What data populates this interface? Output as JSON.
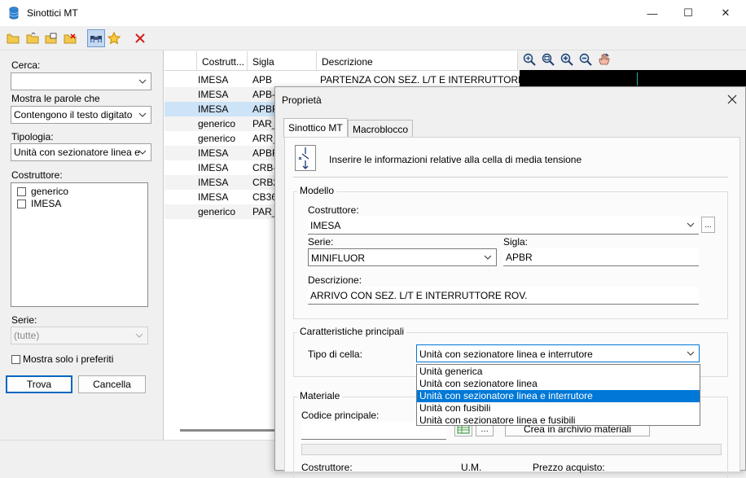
{
  "window": {
    "title": "Sinottici MT",
    "controls": {
      "minimize": "—",
      "maximize": "☐",
      "close": "✕"
    }
  },
  "toolbar": {
    "icons": [
      "new-folder-icon",
      "open-folder-icon",
      "copy-icon",
      "delete-folder-icon",
      "binoculars-icon",
      "star-icon",
      "close-red-icon"
    ]
  },
  "search": {
    "cerca_label": "Cerca:",
    "cerca_value": "",
    "mostra_label": "Mostra le parole che",
    "mostra_value": "Contengono il testo digitato",
    "tipologia_label": "Tipologia:",
    "tipologia_value": "Unità con sezionatore linea e",
    "costruttore_label": "Costruttore:",
    "costruttori": [
      "generico",
      "IMESA"
    ],
    "serie_label": "Serie:",
    "serie_value": "(tutte)",
    "preferiti_label": "Mostra solo i preferiti",
    "trova_label": "Trova",
    "cancella_label": "Cancella"
  },
  "grid": {
    "headers": [
      "Costrutt...",
      "Sigla",
      "Descrizione"
    ],
    "rows": [
      {
        "costruttore": "IMESA",
        "sigla": "APB",
        "descrizione": "PARTENZA CON SEZ. L/T E INTERRUTTORE"
      },
      {
        "costruttore": "IMESA",
        "sigla": "APB-",
        "descrizione": ""
      },
      {
        "costruttore": "IMESA",
        "sigla": "APBR",
        "descrizione": ""
      },
      {
        "costruttore": "generico",
        "sigla": "PAR_",
        "descrizione": ""
      },
      {
        "costruttore": "generico",
        "sigla": "ARR_",
        "descrizione": ""
      },
      {
        "costruttore": "IMESA",
        "sigla": "APBR",
        "descrizione": ""
      },
      {
        "costruttore": "IMESA",
        "sigla": "CRB-",
        "descrizione": ""
      },
      {
        "costruttore": "IMESA",
        "sigla": "CRB2",
        "descrizione": ""
      },
      {
        "costruttore": "IMESA",
        "sigla": "CB36",
        "descrizione": ""
      },
      {
        "costruttore": "generico",
        "sigla": "PAR_",
        "descrizione": ""
      }
    ],
    "selected_row": 2
  },
  "preview_toolbar": {
    "icons": [
      "zoom-fit-icon",
      "zoom-window-icon",
      "zoom-in-icon",
      "zoom-out-icon",
      "pan-icon"
    ]
  },
  "dialog": {
    "title": "Proprietà",
    "tabs": [
      "Sinottico MT",
      "Macroblocco"
    ],
    "info_text": "Inserire le informazioni relative alla cella di media tensione",
    "modello": {
      "title": "Modello",
      "costruttore_label": "Costruttore:",
      "costruttore_value": "IMESA",
      "browse_label": "...",
      "serie_label": "Serie:",
      "serie_value": "MINIFLUOR",
      "sigla_label": "Sigla:",
      "sigla_value": "APBR",
      "descrizione_label": "Descrizione:",
      "descrizione_value": "ARRIVO CON SEZ. L/T E INTERRUTTORE ROV."
    },
    "caratteristiche": {
      "title": "Caratteristiche principali",
      "tipo_label": "Tipo di cella:",
      "tipo_value": "Unità con sezionatore linea e interrutore",
      "options": [
        "Unità generica",
        "Unità con sezionatore linea",
        "Unità con sezionatore linea e interrutore",
        "Unità con fusibili",
        "Unità con sezionatore linea e fusibili"
      ],
      "selected_option": 2
    },
    "materiale": {
      "title": "Materiale",
      "codice_label": "Codice principale:",
      "crea_label": "Crea in archivio materiali",
      "costruttore_label": "Costruttore:",
      "um_label": "U.M.",
      "prezzo_label": "Prezzo acquisto:"
    }
  }
}
